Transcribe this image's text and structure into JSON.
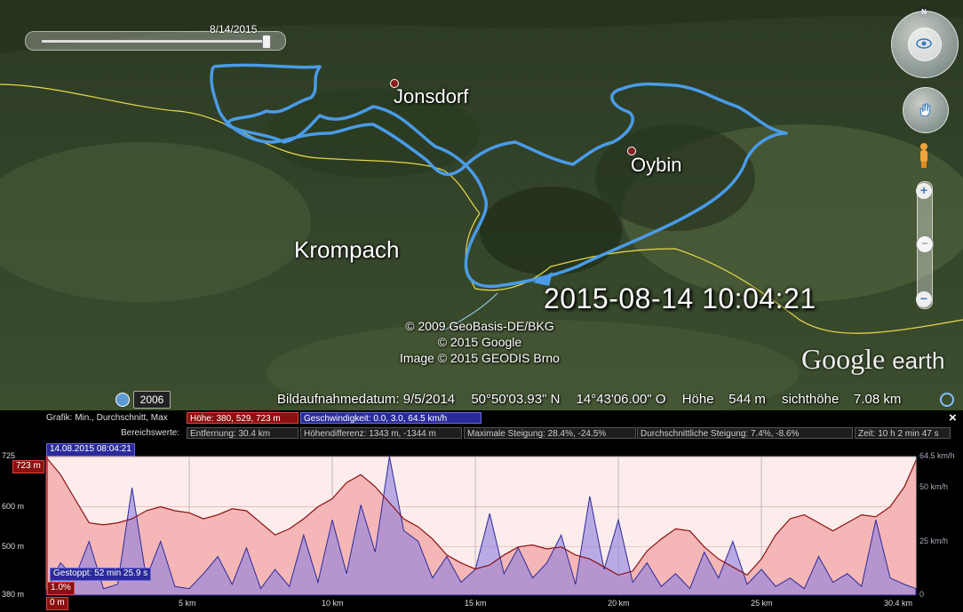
{
  "map": {
    "time_slider": {
      "date": "8/14/2015"
    },
    "places": [
      {
        "name": "Jonsdorf",
        "size": 22,
        "dot": true
      },
      {
        "name": "Oybin",
        "size": 22,
        "dot": true
      },
      {
        "name": "Krompach",
        "size": 26,
        "dot": false
      }
    ],
    "timestamp": "2015-08-14 10:04:21",
    "credits": [
      "© 2009 GeoBasis-DE/BKG",
      "© 2015 Google",
      "Image © 2015 GEODIS Brno"
    ],
    "logo": {
      "google": "Google",
      "earth": "earth"
    },
    "historical_year": "2006",
    "status": {
      "image_date": "Bildaufnahmedatum: 9/5/2014",
      "lat": "50°50'03.93\" N",
      "lon": "14°43'06.00\" O",
      "elevation": "Höhe    544 m",
      "eye_alt": "sichthöhe    7.08 km"
    },
    "nav": {
      "north": "N"
    },
    "zoom": {
      "plus": "+",
      "minus": "−"
    },
    "track_color": "#4a9be8",
    "border_color": "#e6d84a"
  },
  "profile": {
    "graph_label": "Grafik: Min., Durchschnitt, Max",
    "range_label": "Bereichswerte:",
    "height_chip": "Höhe: 380, 529, 723 m",
    "speed_chip": "Geschwindigkeit: 0.0, 3.0, 64.5 km/h",
    "distance": "Entfernung: 30.4 km",
    "height_diff": "Höhendifferenz: 1343 m, -1344 m",
    "max_slope": "Maximale Steigung: 28.4%, -24.5%",
    "avg_slope": "Durchschnittliche Steigung: 7.4%, -8.6%",
    "time": "Zeit: 10 h 2 min 47 s",
    "close": "×",
    "cursor_date": "14.08.2015 08:04:21",
    "max_tag": "723 m",
    "stopped": "Gestoppt: 52 min 25.9 s",
    "slope_pct": "1.0%",
    "zero_tag": "0 m",
    "y_left_ticks": [
      {
        "label": "725",
        "value": 725
      },
      {
        "label": "600 m",
        "value": 600
      },
      {
        "label": "500 m",
        "value": 500
      },
      {
        "label": "380 m",
        "value": 380
      }
    ],
    "y_right_ticks": [
      {
        "label": "64.5 km/h",
        "value": 64.5
      },
      {
        "label": "50 km/h",
        "value": 50
      },
      {
        "label": "25 km/h",
        "value": 25
      },
      {
        "label": "0",
        "value": 0
      }
    ],
    "x_ticks": [
      {
        "label": "5 km",
        "value": 5
      },
      {
        "label": "10 km",
        "value": 10
      },
      {
        "label": "15 km",
        "value": 15
      },
      {
        "label": "20 km",
        "value": 20
      },
      {
        "label": "25 km",
        "value": 25
      },
      {
        "label": "30.4 km",
        "value": 30.4
      }
    ],
    "elevation_color": "#f4b6b6",
    "elevation_line": "#8b1010",
    "speed_color": "#8c7fe0",
    "speed_line": "#2a2a9a"
  },
  "chart_data": {
    "type": "area",
    "xlim": [
      0,
      30.4
    ],
    "ylim_elevation": [
      380,
      725
    ],
    "ylim_speed": [
      0,
      64.5
    ],
    "elevation": {
      "x": [
        0,
        0.5,
        1,
        1.5,
        2,
        2.5,
        3,
        3.5,
        4,
        4.5,
        5,
        5.5,
        6,
        6.5,
        7,
        7.5,
        8,
        8.5,
        9,
        9.5,
        10,
        10.5,
        11,
        11.5,
        12,
        12.5,
        13,
        13.5,
        14,
        14.5,
        15,
        15.5,
        16,
        16.5,
        17,
        17.5,
        18,
        18.5,
        19,
        19.5,
        20,
        20.5,
        21,
        21.5,
        22,
        22.5,
        23,
        23.5,
        24,
        24.5,
        25,
        25.5,
        26,
        26.5,
        27,
        27.5,
        28,
        28.5,
        29,
        29.5,
        30,
        30.4
      ],
      "values": [
        723,
        680,
        620,
        560,
        555,
        560,
        570,
        590,
        600,
        590,
        585,
        570,
        580,
        595,
        590,
        560,
        530,
        545,
        570,
        600,
        620,
        660,
        680,
        650,
        610,
        570,
        550,
        520,
        480,
        460,
        445,
        455,
        480,
        500,
        505,
        495,
        500,
        480,
        470,
        450,
        430,
        440,
        490,
        520,
        545,
        540,
        500,
        470,
        450,
        430,
        470,
        530,
        570,
        580,
        560,
        540,
        560,
        580,
        575,
        600,
        650,
        715
      ]
    },
    "speed": {
      "x": [
        0,
        0.5,
        1,
        1.5,
        2,
        2.5,
        3,
        3.5,
        4,
        4.5,
        5,
        5.5,
        6,
        6.5,
        7,
        7.5,
        8,
        8.5,
        9,
        9.5,
        10,
        10.5,
        11,
        11.5,
        12,
        12.5,
        13,
        13.5,
        14,
        14.5,
        15,
        15.5,
        16,
        16.5,
        17,
        17.5,
        18,
        18.5,
        19,
        19.5,
        20,
        20.5,
        21,
        21.5,
        22,
        22.5,
        23,
        23.5,
        24,
        24.5,
        25,
        25.5,
        26,
        26.5,
        27,
        27.5,
        28,
        28.5,
        29,
        29.5,
        30,
        30.4
      ],
      "values": [
        2,
        15,
        8,
        25,
        3,
        5,
        50,
        8,
        25,
        4,
        3,
        10,
        18,
        5,
        22,
        3,
        12,
        4,
        28,
        6,
        35,
        10,
        42,
        20,
        64.5,
        30,
        25,
        8,
        18,
        6,
        12,
        38,
        10,
        22,
        8,
        15,
        28,
        5,
        46,
        12,
        35,
        6,
        15,
        4,
        10,
        3,
        20,
        8,
        25,
        5,
        12,
        4,
        8,
        3,
        18,
        6,
        10,
        4,
        35,
        8,
        5,
        3
      ]
    }
  }
}
